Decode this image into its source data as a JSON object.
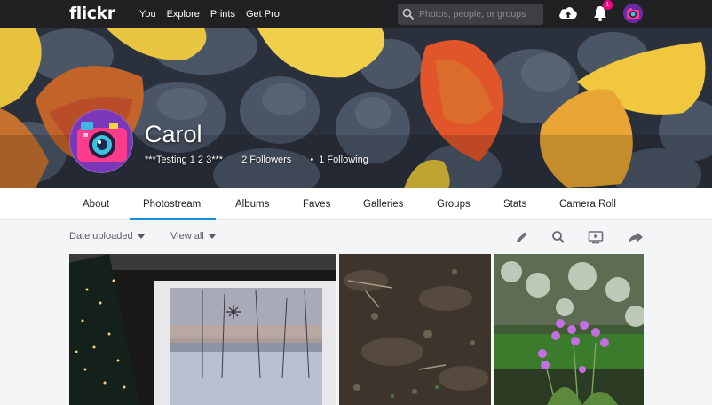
{
  "header": {
    "logo": "flickr",
    "nav": [
      "You",
      "Explore",
      "Prints",
      "Get Pro"
    ],
    "search_placeholder": "Photos, people, or groups",
    "notification_count": "1"
  },
  "profile": {
    "name": "Carol",
    "tagline": "***Testing 1 2 3***",
    "followers": "2 Followers",
    "separator": "•",
    "following": "1 Following"
  },
  "tabs": [
    "About",
    "Photostream",
    "Albums",
    "Faves",
    "Galleries",
    "Groups",
    "Stats",
    "Camera Roll"
  ],
  "active_tab": "Photostream",
  "filters": {
    "sort": "Date uploaded",
    "view": "View all"
  },
  "toolbar_icons": [
    "edit-icon",
    "search-icon",
    "slideshow-icon",
    "share-icon"
  ],
  "colors": {
    "topbar": "#212124",
    "accent": "#128fdc",
    "badge": "#ff0084"
  }
}
